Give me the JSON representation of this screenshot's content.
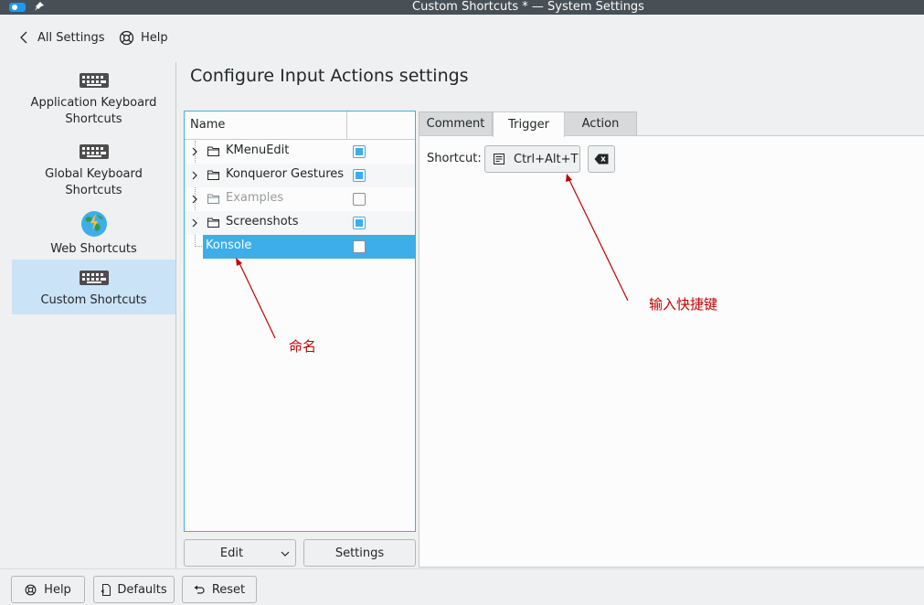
{
  "window": {
    "title": "Custom Shortcuts * — System Settings"
  },
  "nav": {
    "back_label": "All Settings",
    "help_label": "Help"
  },
  "sidebar": {
    "items": [
      {
        "label": "Application Keyboard Shortcuts",
        "line1": "Application Keyboard",
        "line2": "Shortcuts",
        "icon": "keyboard-icon"
      },
      {
        "label": "Global Keyboard Shortcuts",
        "line1": "Global Keyboard",
        "line2": "Shortcuts",
        "icon": "keyboard-icon"
      },
      {
        "label": "Web Shortcuts",
        "line1": "Web Shortcuts",
        "icon": "globe-icon"
      },
      {
        "label": "Custom Shortcuts",
        "line1": "Custom Shortcuts",
        "icon": "keyboard-icon",
        "selected": true
      }
    ]
  },
  "page": {
    "heading": "Configure Input Actions settings"
  },
  "tree": {
    "header": "Name",
    "rows": [
      {
        "label": "KMenuEdit",
        "checked": true
      },
      {
        "label": "Konqueror Gestures",
        "checked": true
      },
      {
        "label": "Examples",
        "checked": false,
        "disabled": true
      },
      {
        "label": "Screenshots",
        "checked": true
      },
      {
        "label": "Konsole",
        "checked": false,
        "selected": true
      }
    ]
  },
  "tree_buttons": {
    "edit_label": "Edit",
    "settings_label": "Settings"
  },
  "tabs": [
    {
      "label": "Comment"
    },
    {
      "label": "Trigger",
      "active": true
    },
    {
      "label": "Action"
    }
  ],
  "trigger": {
    "shortcut_label": "Shortcut:",
    "shortcut_value": "Ctrl+Alt+T"
  },
  "annotations": {
    "name_note": "命名",
    "shortcut_note": "输入快捷键"
  },
  "footer": {
    "help_label": "Help",
    "defaults_label": "Defaults",
    "reset_label": "Reset"
  },
  "colors": {
    "accent": "#3daee9",
    "titlebar": "#475057",
    "annotation": "#c00000"
  }
}
